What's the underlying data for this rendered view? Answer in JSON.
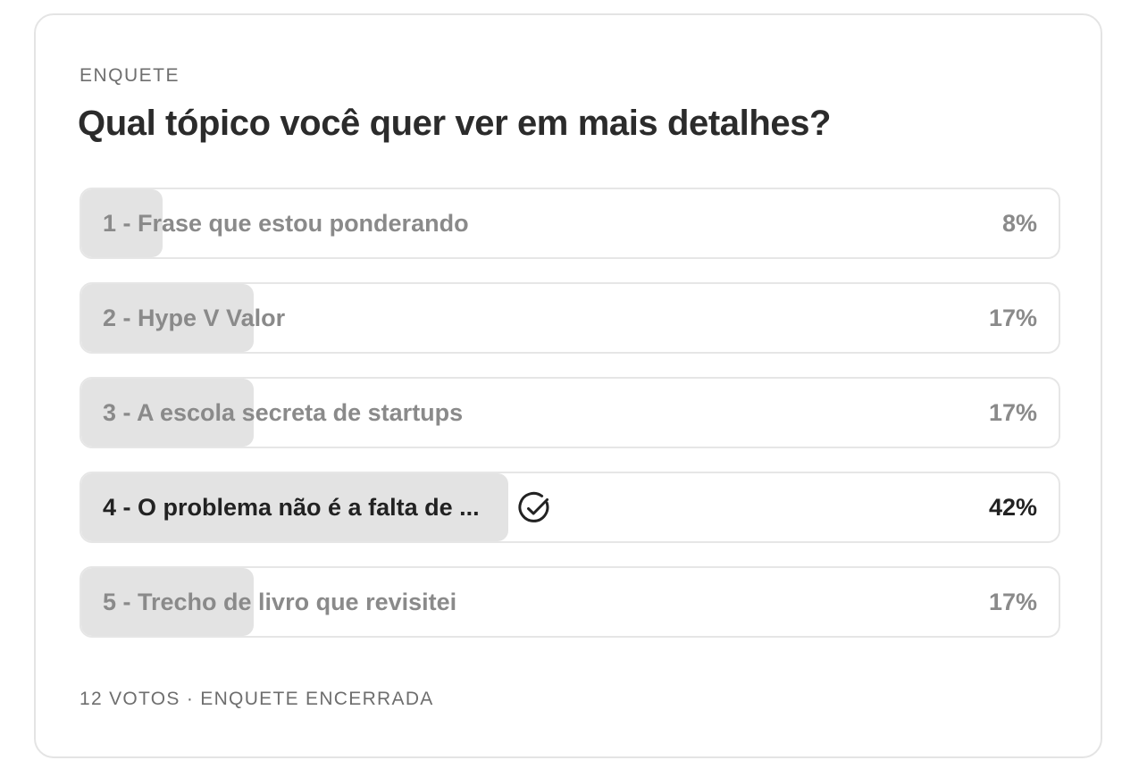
{
  "poll": {
    "label": "ENQUETE",
    "question": "Qual tópico você quer ver em mais detalhes?",
    "options": [
      {
        "label": "1 - Frase que estou ponderando",
        "percent": "8%",
        "share": 0.08,
        "selected": false
      },
      {
        "label": "2 - Hype V Valor",
        "percent": "17%",
        "share": 0.17,
        "selected": false
      },
      {
        "label": "3 - A escola secreta de startups",
        "percent": "17%",
        "share": 0.17,
        "selected": false
      },
      {
        "label": "4 - O problema não é a falta de ...",
        "percent": "42%",
        "share": 0.42,
        "selected": true
      },
      {
        "label": "5 - Trecho de livro que revisitei",
        "percent": "17%",
        "share": 0.17,
        "selected": false
      }
    ],
    "footer": "12 VOTOS · ENQUETE ENCERRADA"
  },
  "colors": {
    "fill": "#e3e3e3",
    "border": "#e6e6e6",
    "text_muted": "#8a8a8a",
    "text_strong": "#222222"
  },
  "icons": {
    "selected_marker": "check-circle-icon"
  }
}
